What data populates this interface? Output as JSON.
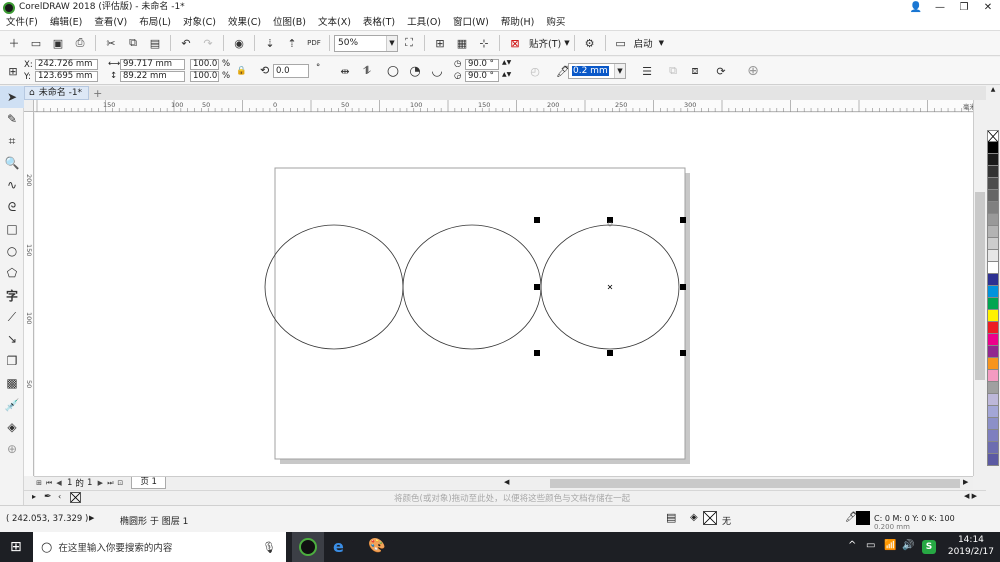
{
  "window": {
    "title": "CorelDRAW 2018 (评估版) - 未命名 -1*",
    "controls": [
      "👤",
      "—",
      "❐",
      "✕"
    ]
  },
  "menu": [
    "文件(F)",
    "编辑(E)",
    "查看(V)",
    "布局(L)",
    "对象(C)",
    "效果(C)",
    "位图(B)",
    "文本(X)",
    "表格(T)",
    "工具(O)",
    "窗口(W)",
    "帮助(H)",
    "购买"
  ],
  "toolbar": {
    "zoom": "50%",
    "snap_label": "贴齐(T)",
    "launch_label": "启动"
  },
  "props": {
    "x_label": "X:",
    "x": "242.726 mm",
    "y_label": "Y:",
    "y": "123.695 mm",
    "width": "99.717 mm",
    "height": "89.22 mm",
    "scale_w": "100.0",
    "scale_h": "100.0",
    "pct": "%",
    "rotation": "0.0",
    "deg": "°",
    "start_angle": "90.0 °",
    "end_angle": "90.0 °",
    "outline": "0.2 mm"
  },
  "tab": {
    "doc_name": "未命名 -1*",
    "add": "+"
  },
  "ruler": {
    "h_labels": [
      "150",
      "100",
      "50",
      "0",
      "50",
      "100",
      "150",
      "200",
      "250",
      "300"
    ],
    "v_labels": [
      "200",
      "150",
      "100",
      "50"
    ],
    "units": "毫米"
  },
  "pagenav": {
    "page_num": "1",
    "of": "的",
    "total": "1",
    "page_tab": "页 1"
  },
  "colorstrip": {
    "hint": "将颜色(或对象)拖动至此处，以便将这些颜色与文档存储在一起"
  },
  "status": {
    "coords": "( 242.053, 37.329 )",
    "object_info": "椭圆形 于 图层 1",
    "fill_label": "无",
    "color_info": "C: 0 M: 0 Y: 0 K: 100",
    "outline_size": "0.200 mm"
  },
  "taskbar": {
    "search_placeholder": "在这里输入你要搜索的内容",
    "time": "14:14",
    "date": "2019/2/17"
  },
  "palette_colors": [
    "#000000",
    "#1a1a1a",
    "#333333",
    "#4d4d4d",
    "#666666",
    "#808080",
    "#999999",
    "#b3b3b3",
    "#cccccc",
    "#e6e6e6",
    "#ffffff",
    "#2e3192",
    "#0093dd",
    "#00a651",
    "#fff200",
    "#ed1c24",
    "#ec008c",
    "#92278f",
    "#f7941d",
    "#f49ac1",
    "#a0a0a0",
    "#bdb7d9",
    "#a3a6d6",
    "#8c90c8",
    "#7e7fbf",
    "#6d6db0",
    "#5c5aa3"
  ]
}
